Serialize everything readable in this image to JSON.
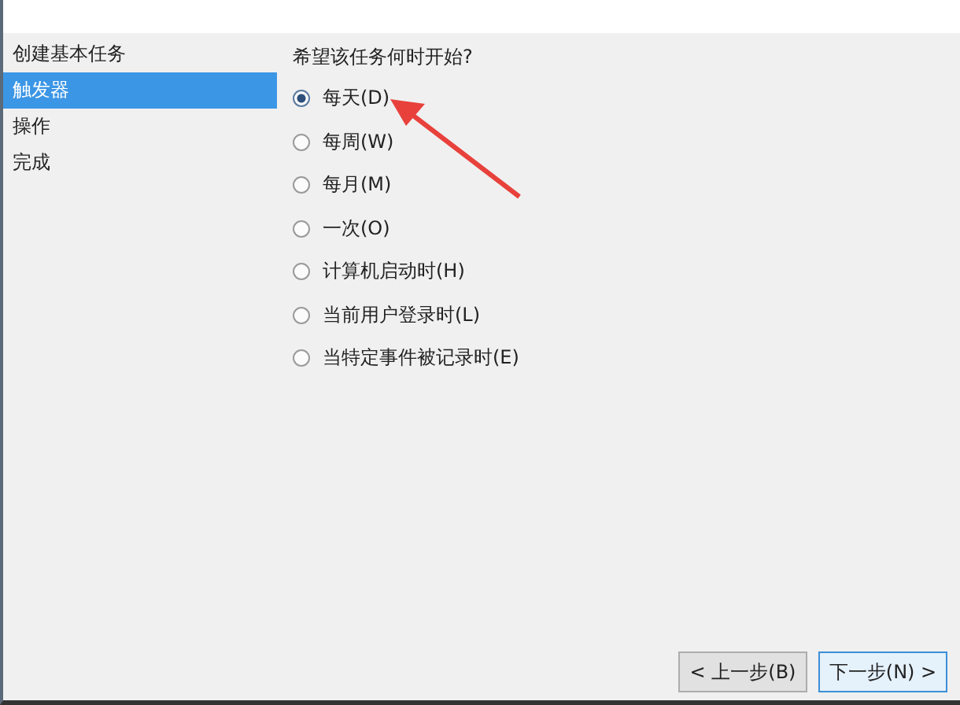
{
  "sidebar": {
    "items": [
      {
        "label": "创建基本任务",
        "selected": false
      },
      {
        "label": "触发器",
        "selected": true
      },
      {
        "label": "操作",
        "selected": false
      },
      {
        "label": "完成",
        "selected": false
      }
    ]
  },
  "question": "希望该任务何时开始?",
  "options": [
    {
      "label": "每天(D)",
      "selected": true
    },
    {
      "label": "每周(W)",
      "selected": false
    },
    {
      "label": "每月(M)",
      "selected": false
    },
    {
      "label": "一次(O)",
      "selected": false
    },
    {
      "label": "计算机启动时(H)",
      "selected": false
    },
    {
      "label": "当前用户登录时(L)",
      "selected": false
    },
    {
      "label": "当特定事件被记录时(E)",
      "selected": false
    }
  ],
  "buttons": [
    {
      "label": "< 上一步(B)",
      "default": false
    },
    {
      "label": "下一步(N) >",
      "default": true
    }
  ]
}
